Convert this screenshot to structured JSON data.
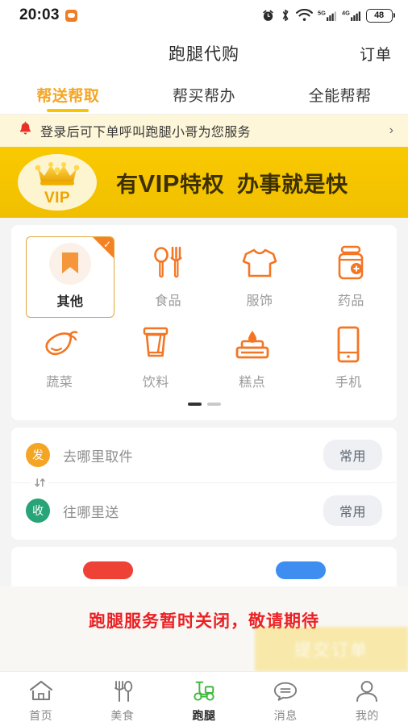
{
  "statusbar": {
    "time": "20:03",
    "battery_level": "48",
    "icons": [
      "message-icon",
      "alarm-icon",
      "bluetooth-icon",
      "wifi-icon",
      "signal-5g-icon",
      "signal-4g-icon",
      "battery-icon"
    ]
  },
  "header": {
    "title": "跑腿代购",
    "action_label": "订单"
  },
  "tabs": [
    {
      "label": "帮送帮取",
      "active": true
    },
    {
      "label": "帮买帮办",
      "active": false
    },
    {
      "label": "全能帮帮",
      "active": false
    }
  ],
  "notice": {
    "icon": "bell-icon",
    "text": "登录后可下单呼叫跑腿小哥为您服务",
    "arrow": "›"
  },
  "vip_banner": {
    "badge_label": "VIP",
    "title_part1": "有",
    "title_big": "VIP",
    "title_part2": "特权",
    "title_part3": "办事就是快",
    "bg_color": "#f7c600"
  },
  "categories": {
    "row1": [
      {
        "label": "其他",
        "icon": "bookmark-icon",
        "selected": true
      },
      {
        "label": "食品",
        "icon": "cutlery-icon",
        "selected": false
      },
      {
        "label": "服饰",
        "icon": "tshirt-icon",
        "selected": false
      },
      {
        "label": "药品",
        "icon": "medicine-bottle-icon",
        "selected": false
      }
    ],
    "row2": [
      {
        "label": "蔬菜",
        "icon": "eggplant-icon",
        "selected": false
      },
      {
        "label": "饮料",
        "icon": "drink-cup-icon",
        "selected": false
      },
      {
        "label": "糕点",
        "icon": "cake-icon",
        "selected": false
      },
      {
        "label": "手机",
        "icon": "phone-icon",
        "selected": false
      }
    ],
    "pages": 2,
    "current_page": 1
  },
  "address": {
    "pickup": {
      "badge": "发",
      "placeholder": "去哪里取件",
      "chip": "常用",
      "badge_color": "#f5a524"
    },
    "dropoff": {
      "badge": "收",
      "placeholder": "往哪里送",
      "chip": "常用",
      "badge_color": "#27a478"
    },
    "swap_icon": "swap-vertical-icon"
  },
  "overlay": {
    "message": "跑腿服务暂时关闭，敬请期待",
    "message_color": "#ec2024",
    "submit_label": "提交订单"
  },
  "tabbar": [
    {
      "label": "首页",
      "icon": "home-icon",
      "active": false
    },
    {
      "label": "美食",
      "icon": "cutlery-icon",
      "active": false
    },
    {
      "label": "跑腿",
      "icon": "scooter-icon",
      "active": true
    },
    {
      "label": "消息",
      "icon": "message-bubble-icon",
      "active": false
    },
    {
      "label": "我的",
      "icon": "person-icon",
      "active": false
    }
  ]
}
